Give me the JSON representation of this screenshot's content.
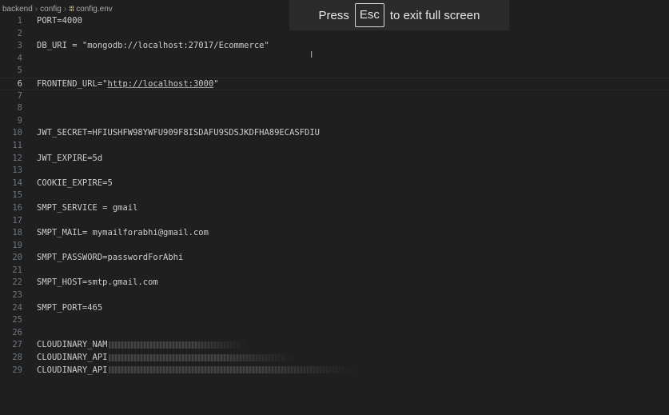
{
  "breadcrumb": {
    "segments": [
      "backend",
      "config"
    ],
    "file_icon": "settings-file-icon",
    "file_name": "config.env"
  },
  "fullscreen_banner": {
    "prefix": "Press",
    "key": "Esc",
    "suffix": "to exit full screen"
  },
  "lines": [
    {
      "n": "1",
      "text": "PORT=4000"
    },
    {
      "n": "2",
      "text": ""
    },
    {
      "n": "3",
      "text": "DB_URI = \"mongodb://localhost:27017/Ecommerce\""
    },
    {
      "n": "4",
      "text": ""
    },
    {
      "n": "5",
      "text": ""
    },
    {
      "n": "6",
      "text_pre": "FRONTEND_URL=\"",
      "url": "http://localhost:3000",
      "text_post": "\""
    },
    {
      "n": "7",
      "text": ""
    },
    {
      "n": "8",
      "text": ""
    },
    {
      "n": "9",
      "text": ""
    },
    {
      "n": "10",
      "text": "JWT_SECRET=HFIUSHFW98YWFU909F8ISDAFU9SDSJKDFHA89ECASFDIU"
    },
    {
      "n": "11",
      "text": ""
    },
    {
      "n": "12",
      "text": "JWT_EXPIRE=5d"
    },
    {
      "n": "13",
      "text": ""
    },
    {
      "n": "14",
      "text": "COOKIE_EXPIRE=5"
    },
    {
      "n": "15",
      "text": ""
    },
    {
      "n": "16",
      "text": "SMPT_SERVICE = gmail"
    },
    {
      "n": "17",
      "text": ""
    },
    {
      "n": "18",
      "text": "SMPT_MAIL= mymailforabhi@gmail.com"
    },
    {
      "n": "19",
      "text": ""
    },
    {
      "n": "20",
      "text": "SMPT_PASSWORD=passwordForAbhi"
    },
    {
      "n": "21",
      "text": ""
    },
    {
      "n": "22",
      "text": "SMPT_HOST=smtp.gmail.com"
    },
    {
      "n": "23",
      "text": ""
    },
    {
      "n": "24",
      "text": "SMPT_PORT=465"
    },
    {
      "n": "25",
      "text": ""
    },
    {
      "n": "26",
      "text": ""
    },
    {
      "n": "27",
      "text": "CLOUDINARY_NAM"
    },
    {
      "n": "28",
      "text": "CLOUDINARY_API"
    },
    {
      "n": "29",
      "text": "CLOUDINARY_API"
    }
  ]
}
